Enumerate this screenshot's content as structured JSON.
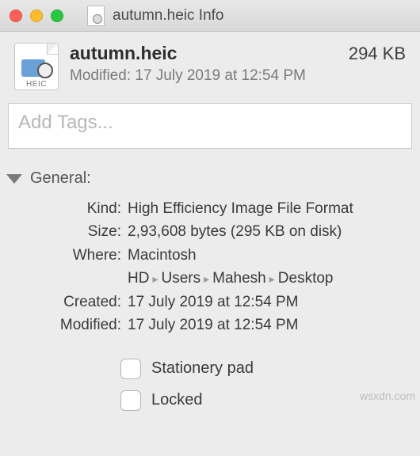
{
  "window": {
    "title": "autumn.heic Info",
    "icon_badge": "HEIC"
  },
  "header": {
    "filename": "autumn.heic",
    "size_display": "294 KB",
    "modified_line": "Modified: 17 July 2019 at 12:54 PM",
    "icon_badge": "HEIC"
  },
  "tags": {
    "placeholder": "Add Tags...",
    "value": ""
  },
  "section": {
    "general_label": "General:"
  },
  "general": {
    "kind_label": "Kind:",
    "kind_value": "High Efficiency Image File Format",
    "size_label": "Size:",
    "size_value": "2,93,608 bytes (295 KB on disk)",
    "where_label": "Where:",
    "where_segments": [
      "Macintosh HD",
      "Users",
      "Mahesh",
      "Desktop"
    ],
    "created_label": "Created:",
    "created_value": "17 July 2019 at 12:54 PM",
    "modified_label": "Modified:",
    "modified_value": "17 July 2019 at 12:54 PM"
  },
  "checks": {
    "stationery_label": "Stationery pad",
    "stationery_checked": false,
    "locked_label": "Locked",
    "locked_checked": false
  },
  "watermark": "wsxdn.com"
}
